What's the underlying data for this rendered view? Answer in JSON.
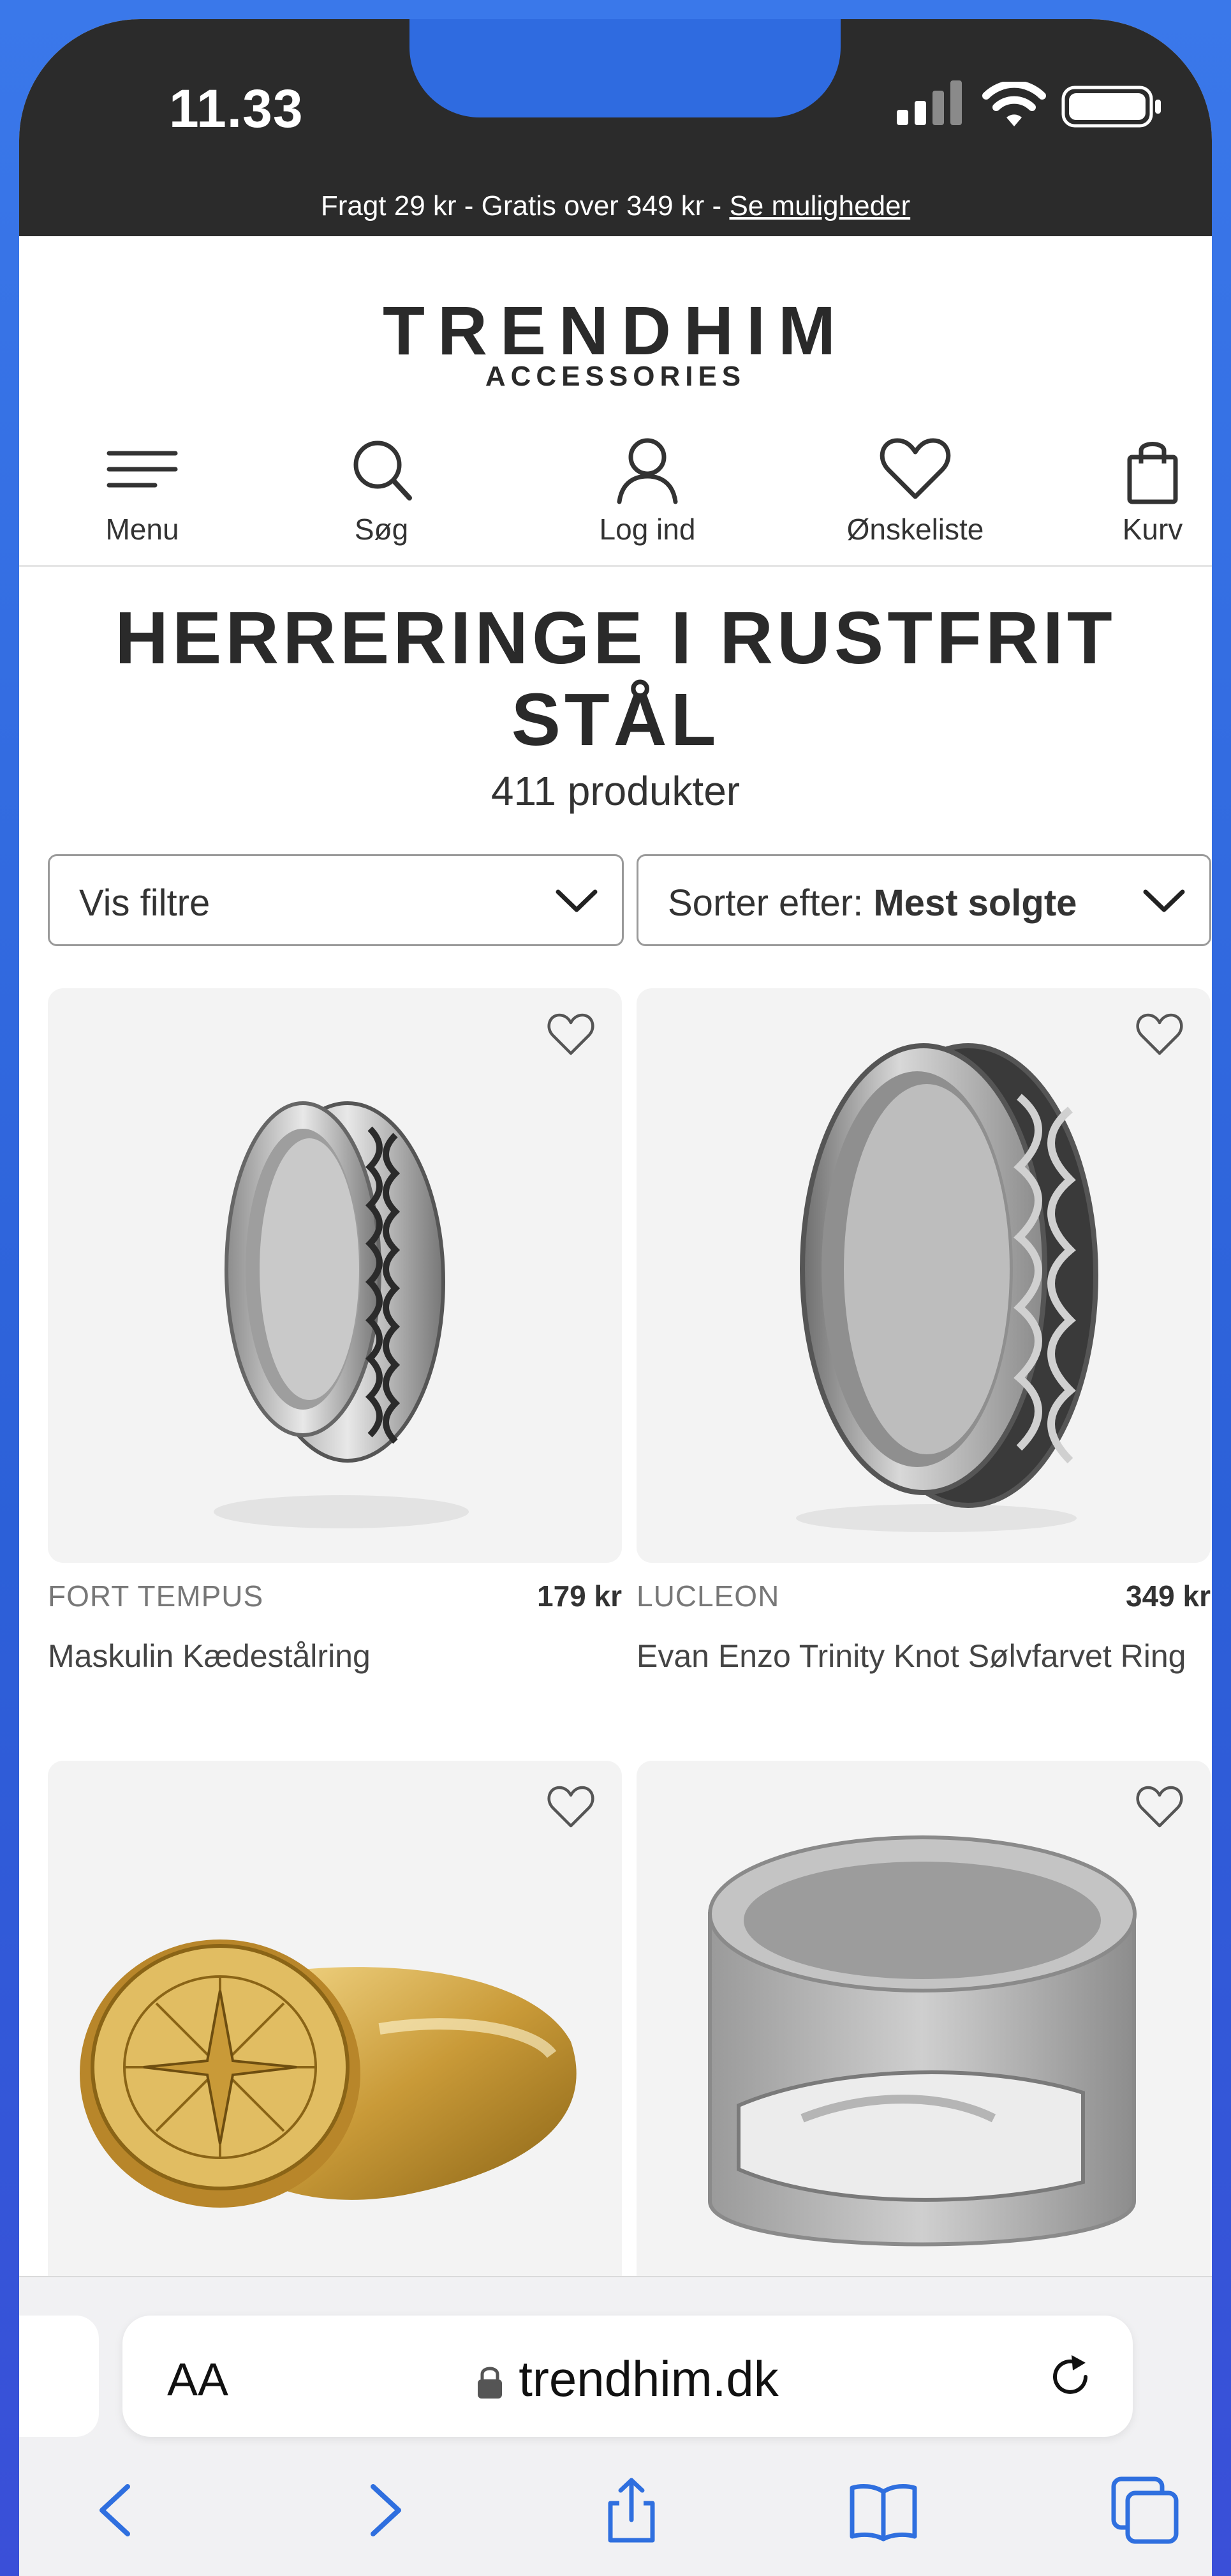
{
  "status_bar": {
    "time": "11.33",
    "promo_text": "Fragt 29 kr - Gratis over 349 kr  - ",
    "promo_link": "Se muligheder"
  },
  "header": {
    "logo": "TRENDHIM",
    "logo_sub": "ACCESSORIES",
    "nav": [
      {
        "label": "Menu",
        "icon": "menu-icon"
      },
      {
        "label": "Søg",
        "icon": "search-icon"
      },
      {
        "label": "Log ind",
        "icon": "user-icon"
      },
      {
        "label": "Ønskeliste",
        "icon": "heart-icon"
      },
      {
        "label": "Kurv",
        "icon": "bag-icon"
      }
    ]
  },
  "page": {
    "title": "HERRERINGE I RUSTFRIT STÅL",
    "count": "411 produkter",
    "filter_label": "Vis filtre",
    "sort_prefix": "Sorter efter:",
    "sort_value": "Mest solgte"
  },
  "products": [
    {
      "brand": "FORT TEMPUS",
      "price": "179 kr",
      "name": "Maskulin Kædestålring"
    },
    {
      "brand": "LUCLEON",
      "price": "349 kr",
      "name": "Evan Enzo Trinity Knot Sølvfarvet Ring"
    },
    {
      "brand": "",
      "price": "",
      "name": ""
    },
    {
      "brand": "",
      "price": "",
      "name": ""
    }
  ],
  "browser": {
    "text_size": "AA",
    "url": "trendhim.dk"
  }
}
